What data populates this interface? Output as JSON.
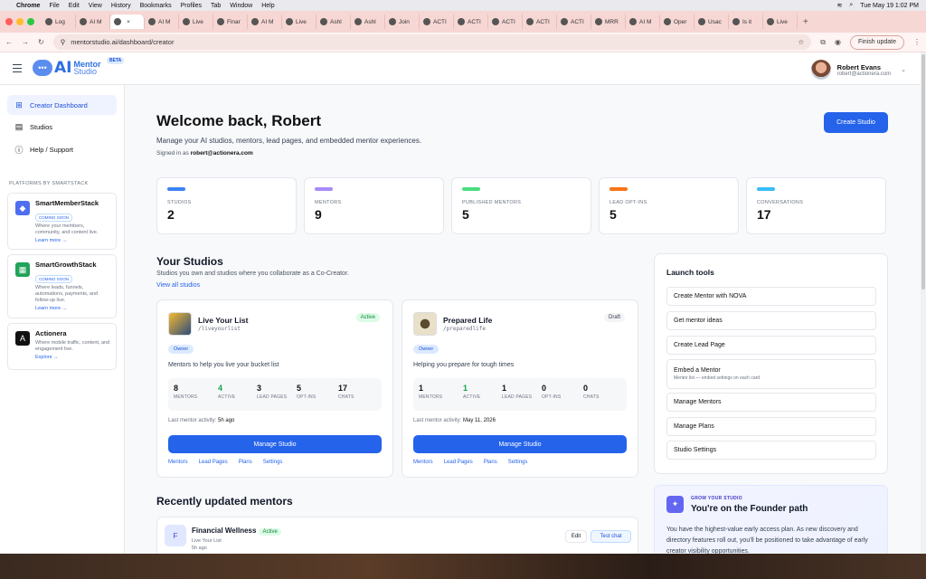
{
  "menubar": {
    "app": "Chrome",
    "items": [
      "File",
      "Edit",
      "View",
      "History",
      "Bookmarks",
      "Profiles",
      "Tab",
      "Window",
      "Help"
    ],
    "datetime": "Tue May 19  1:02 PM"
  },
  "tabs": [
    "Log",
    "AI M",
    "",
    "AI M",
    "Live",
    "Finar",
    "AI M",
    "Live",
    "Ashl",
    "Ashl",
    "Join",
    "ACTI",
    "ACTI",
    "ACTI",
    "ACTI",
    "ACTI",
    "MRR",
    "AI M",
    "Oper",
    "Usac",
    "Is it",
    "Live"
  ],
  "toolbar": {
    "url": "mentorstudio.ai/dashboard/creator",
    "finish": "Finish update"
  },
  "header": {
    "logo_ai": "AI",
    "logo_mentor": "Mentor",
    "logo_studio": "Studio",
    "beta": "BETA",
    "user_name": "Robert Evans",
    "user_email": "robert@actionera.com"
  },
  "sidebar": {
    "nav": [
      {
        "label": "Creator Dashboard"
      },
      {
        "label": "Studios"
      },
      {
        "label": "Help / Support"
      }
    ],
    "platforms_title": "PLATFORMS BY SMARTSTACK",
    "platforms": [
      {
        "title": "SmartMemberStack",
        "soon": "COMING SOON",
        "desc": "Where your members, community, and content live.",
        "link": "Learn more →"
      },
      {
        "title": "SmartGrowthStack",
        "soon": "COMING SOON",
        "desc": "Where leads, funnels, automations, payments, and follow-up live.",
        "link": "Learn more →"
      },
      {
        "title": "Actionera",
        "desc": "Where mobile traffic, content, and engagement live.",
        "link": "Explore →"
      }
    ]
  },
  "main": {
    "welcome": "Welcome back, Robert",
    "subtitle": "Manage your AI studios, mentors, lead pages, and embedded mentor experiences.",
    "signed_prefix": "Signed in as ",
    "signed_email": "robert@actionera.com",
    "create_btn": "Create Studio",
    "stats": [
      {
        "label": "STUDIOS",
        "value": "2",
        "color": "#3b82f6"
      },
      {
        "label": "MENTORS",
        "value": "9",
        "color": "#a78bfa"
      },
      {
        "label": "PUBLISHED MENTORS",
        "value": "5",
        "color": "#4ade80"
      },
      {
        "label": "LEAD OPT-INS",
        "value": "5",
        "color": "#f97316"
      },
      {
        "label": "CONVERSATIONS",
        "value": "17",
        "color": "#38bdf8"
      }
    ],
    "your_studios": "Your Studios",
    "your_studios_desc": "Studios you own and studios where you collaborate as a Co-Creator.",
    "view_all": "View all studios",
    "studios": [
      {
        "name": "Live Your List",
        "slug": "/liveyourlist",
        "status": "Active",
        "role": "Owner",
        "desc": "Mentors to help you live your bucket list",
        "metrics": [
          {
            "v": "8",
            "l": "MENTORS"
          },
          {
            "v": "4",
            "l": "ACTIVE"
          },
          {
            "v": "3",
            "l": "LEAD PAGES"
          },
          {
            "v": "5",
            "l": "OPT-INS"
          },
          {
            "v": "17",
            "l": "CHATS"
          }
        ],
        "activity_label": "Last mentor activity: ",
        "activity": "5h ago",
        "manage": "Manage Studio",
        "links": [
          "Mentors",
          "Lead Pages",
          "Plans",
          "Settings"
        ]
      },
      {
        "name": "Prepared Life",
        "slug": "/preparedlife",
        "status": "Draft",
        "role": "Owner",
        "desc": "Helping you prepare for tough times",
        "metrics": [
          {
            "v": "1",
            "l": "MENTORS"
          },
          {
            "v": "1",
            "l": "ACTIVE"
          },
          {
            "v": "1",
            "l": "LEAD PAGES"
          },
          {
            "v": "0",
            "l": "OPT-INS"
          },
          {
            "v": "0",
            "l": "CHATS"
          }
        ],
        "activity_label": "Last mentor activity: ",
        "activity": "May 11, 2026",
        "manage": "Manage Studio",
        "links": [
          "Mentors",
          "Lead Pages",
          "Plans",
          "Settings"
        ]
      }
    ],
    "launch_title": "Launch tools",
    "launch": [
      {
        "label": "Create Mentor with NOVA"
      },
      {
        "label": "Get mentor ideas"
      },
      {
        "label": "Create Lead Page"
      },
      {
        "label": "Embed a Mentor",
        "sub": "Mentor list — embed settings on each card"
      },
      {
        "label": "Manage Mentors"
      },
      {
        "label": "Manage Plans"
      },
      {
        "label": "Studio Settings"
      }
    ],
    "recent_title": "Recently updated mentors",
    "recent": {
      "initial": "F",
      "name": "Financial Wellness",
      "status": "Active",
      "studio": "Live Your List",
      "time": "5h ago",
      "edit": "Edit",
      "test": "Test chat"
    },
    "founder": {
      "kicker": "GROW YOUR STUDIO",
      "title": "You're on the Founder path",
      "desc": "You have the highest-value early access plan. As new discovery and directory features roll out, you'll be positioned to take advantage of early creator visibility opportunities."
    }
  }
}
